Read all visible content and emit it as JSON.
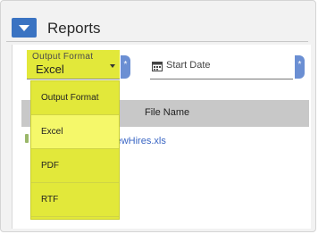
{
  "header": {
    "title": "Reports",
    "collapse_icon": "chevron-down-icon",
    "accent_color": "#3a73c2"
  },
  "output_format": {
    "label": "Output Format",
    "value": "Excel",
    "options": [
      "Output Format",
      "Excel",
      "PDF",
      "RTF"
    ],
    "selected_option": "Excel",
    "highlight_color": "#e2e83a"
  },
  "required_marker": "*",
  "start_date": {
    "label": "Start Date",
    "icon": "calendar-icon"
  },
  "table": {
    "column_header": "File Name",
    "rows": [
      {
        "file_name": "-NewHires.xls"
      }
    ]
  }
}
